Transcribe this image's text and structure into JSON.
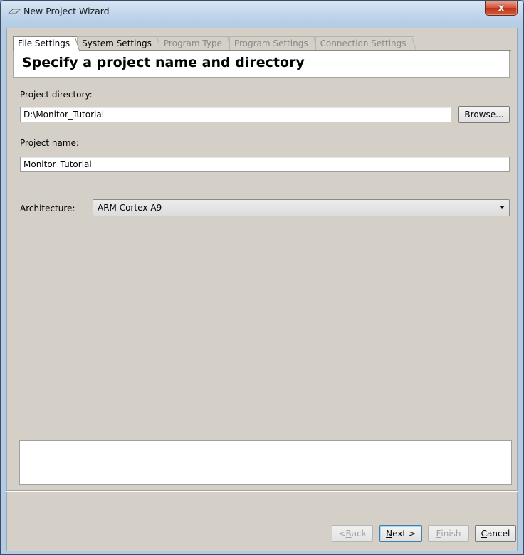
{
  "window": {
    "title": "New Project Wizard",
    "close_label": "x"
  },
  "tabs": [
    {
      "label": "File Settings",
      "state": "active"
    },
    {
      "label": "System Settings",
      "state": "enabled"
    },
    {
      "label": "Program Type",
      "state": "disabled"
    },
    {
      "label": "Program Settings",
      "state": "disabled"
    },
    {
      "label": "Connection Settings",
      "state": "disabled"
    }
  ],
  "page": {
    "heading": "Specify a project name and directory"
  },
  "form": {
    "project_directory_label": "Project directory:",
    "project_directory_value": "D:\\Monitor_Tutorial",
    "browse_label": "Browse...",
    "project_name_label": "Project name:",
    "project_name_value": "Monitor_Tutorial",
    "architecture_label": "Architecture:",
    "architecture_value": "ARM Cortex-A9"
  },
  "message_box": {
    "text": ""
  },
  "footer": {
    "back_prefix": "< ",
    "back_mnemonic": "B",
    "back_rest": "ack",
    "next_mnemonic": "N",
    "next_rest": "ext >",
    "finish_mnemonic": "F",
    "finish_rest": "inish",
    "cancel_mnemonic": "C",
    "cancel_rest": "ancel"
  }
}
